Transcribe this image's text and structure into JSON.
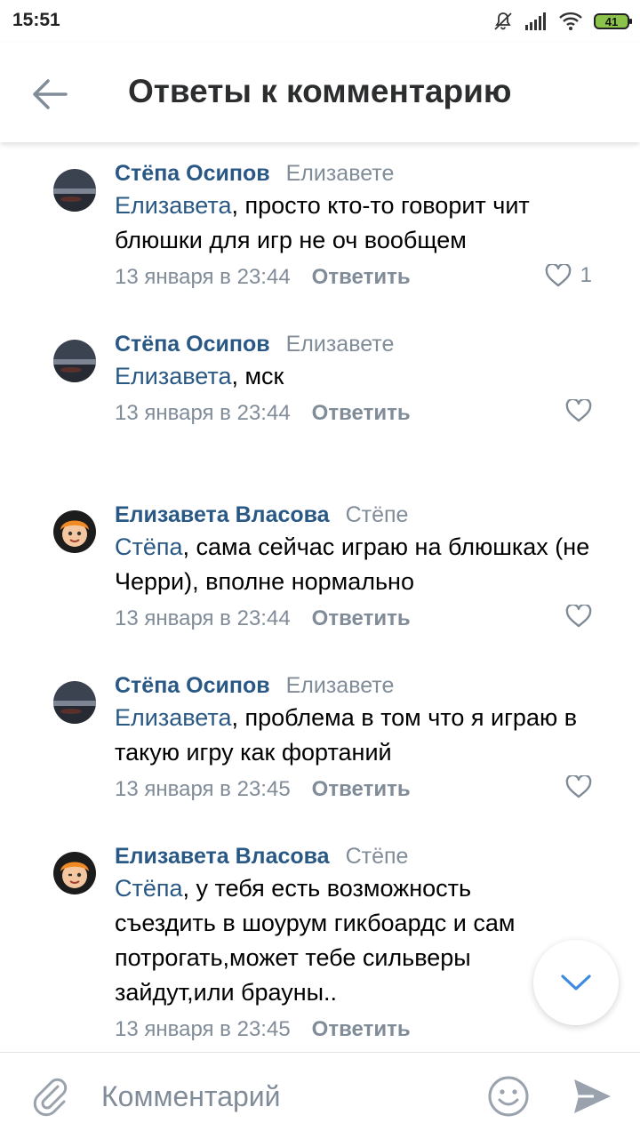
{
  "status_bar": {
    "time": "15:51",
    "battery": "41"
  },
  "header": {
    "title": "Ответы к комментарию"
  },
  "comments": [
    {
      "author": "Стёпа Осипов",
      "reply_to": "Елизавете",
      "mention": "Елизавета",
      "text": ", просто кто-то говорит чит блюшки для игр не оч вообщем",
      "date": "13 января в 23:44",
      "reply_label": "Ответить",
      "likes": "1"
    },
    {
      "author": "Стёпа Осипов",
      "reply_to": "Елизавете",
      "mention": "Елизавета",
      "text": ", мск",
      "date": "13 января в 23:44",
      "reply_label": "Ответить",
      "likes": ""
    },
    {
      "author": "Елизавета Власова",
      "reply_to": "Стёпе",
      "mention": "Стёпа",
      "text": ", сама сейчас играю на блюшках (не Черри), вполне нормально",
      "date": "13 января в 23:44",
      "reply_label": "Ответить",
      "likes": ""
    },
    {
      "author": "Стёпа Осипов",
      "reply_to": "Елизавете",
      "mention": "Елизавета",
      "text": ", проблема в том что я играю в такую игру как фортаний",
      "date": "13 января в 23:45",
      "reply_label": "Ответить",
      "likes": ""
    },
    {
      "author": "Елизавета Власова",
      "reply_to": "Стёпе",
      "mention": "Стёпа",
      "text": ", у тебя есть возможность съездить в шоурум гикбоардс и сам потрогать,может тебе сильверы зайдут,или брауны..",
      "date": "13 января в 23:45",
      "reply_label": "Ответить",
      "likes": ""
    }
  ],
  "composer": {
    "placeholder": "Комментарий"
  },
  "colors": {
    "link": "#2a5885",
    "secondary": "#818c99",
    "accent": "#3f8ae0"
  }
}
